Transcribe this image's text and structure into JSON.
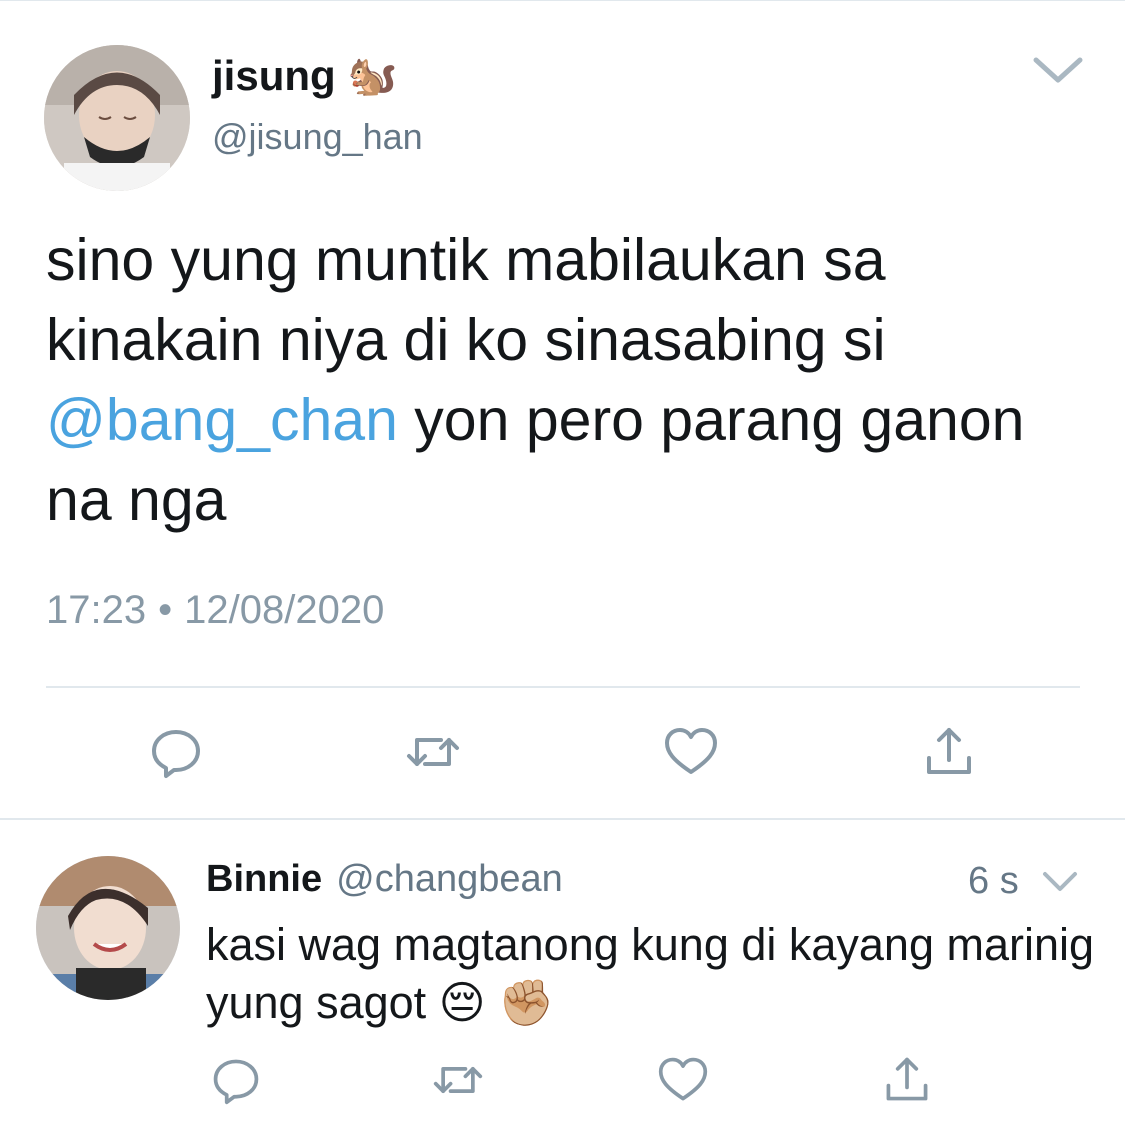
{
  "main_tweet": {
    "display_name": "jisung",
    "name_emoji": "🐿️",
    "handle": "@jisung_han",
    "text_before_mention": "sino yung muntik mabilaukan sa kinakain niya di ko sinasabing si ",
    "mention": "@bang_chan",
    "text_after_mention": " yon pero parang ganon na nga",
    "time": "17:23",
    "separator": "•",
    "date": "12/08/2020"
  },
  "reply": {
    "display_name": "Binnie",
    "handle": "@changbean",
    "time": "6 s",
    "text": "kasi wag magtanong kung di kayang marinig yung sagot",
    "emojis": "😔 ✊🏼"
  },
  "icons": [
    "reply-icon",
    "retweet-icon",
    "like-icon",
    "share-icon",
    "chevron-down-icon"
  ],
  "colors": {
    "text": "#14171a",
    "secondary": "#657786",
    "timestamp": "#8899a6",
    "link": "#4aa3df",
    "icon": "#8899a6",
    "divider": "#e1e8ed"
  }
}
